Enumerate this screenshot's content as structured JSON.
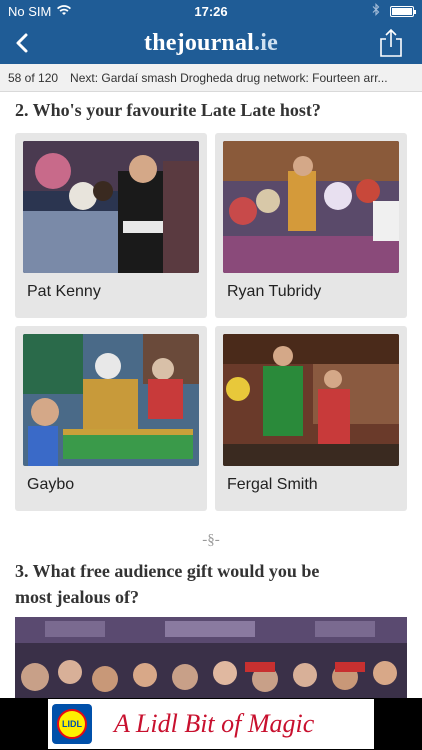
{
  "status": {
    "carrier": "No SIM",
    "time": "17:26"
  },
  "nav": {
    "logo_prefix": "thejournal",
    "logo_suffix": ".ie"
  },
  "next_bar": {
    "count": "58 of 120",
    "next_label": "Next: Gardaí smash Drogheda drug network: Fourteen arr..."
  },
  "question2": {
    "title": "2. Who's your favourite Late Late host?",
    "options": [
      {
        "label": "Pat Kenny"
      },
      {
        "label": "Ryan Tubridy"
      },
      {
        "label": "Gaybo"
      },
      {
        "label": "Fergal Smith"
      }
    ]
  },
  "separator": "-§-",
  "question3": {
    "title_line1": "3. What free audience gift would you be",
    "title_line2": "most jealous of?"
  },
  "ad": {
    "logo_text": "LIDL",
    "text": "A Lidl Bit of Magic"
  }
}
